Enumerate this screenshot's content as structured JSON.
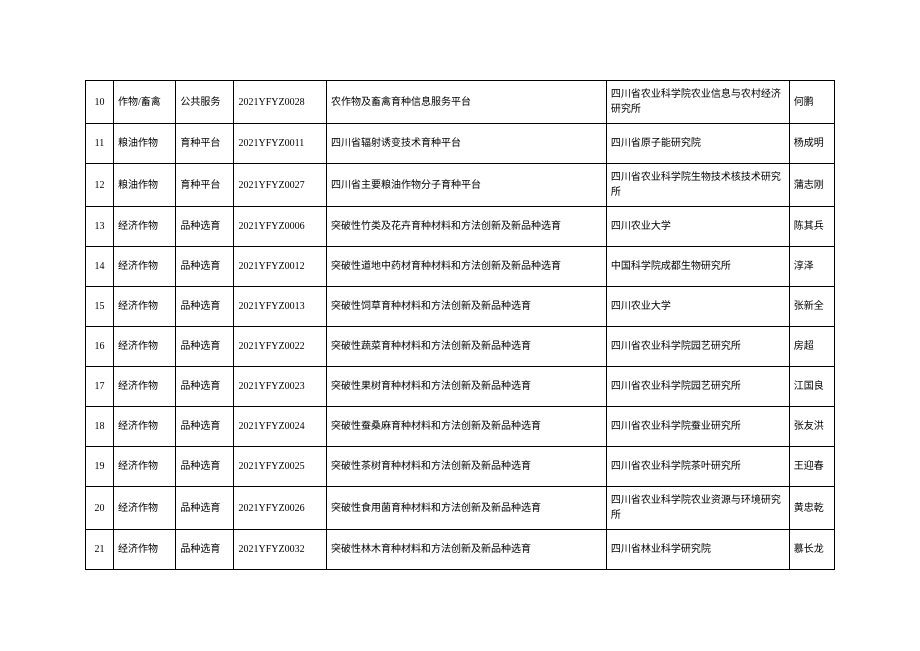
{
  "rows": [
    {
      "idx": "10",
      "cat": "作物/畜禽",
      "type": "公共服务",
      "code": "2021YFYZ0028",
      "title": "农作物及畜禽育种信息服务平台",
      "org": "四川省农业科学院农业信息与农村经济研究所",
      "person": "何鹏"
    },
    {
      "idx": "11",
      "cat": "粮油作物",
      "type": "育种平台",
      "code": "2021YFYZ0011",
      "title": "四川省辐射诱变技术育种平台",
      "org": "四川省原子能研究院",
      "person": "杨成明"
    },
    {
      "idx": "12",
      "cat": "粮油作物",
      "type": "育种平台",
      "code": "2021YFYZ0027",
      "title": "四川省主要粮油作物分子育种平台",
      "org": "四川省农业科学院生物技术核技术研究所",
      "person": "蒲志刚"
    },
    {
      "idx": "13",
      "cat": "经济作物",
      "type": "品种选育",
      "code": "2021YFYZ0006",
      "title": "突破性竹类及花卉育种材料和方法创新及新品种选育",
      "org": "四川农业大学",
      "person": "陈其兵"
    },
    {
      "idx": "14",
      "cat": "经济作物",
      "type": "品种选育",
      "code": "2021YFYZ0012",
      "title": "突破性道地中药材育种材料和方法创新及新品种选育",
      "org": "中国科学院成都生物研究所",
      "person": "淳泽"
    },
    {
      "idx": "15",
      "cat": "经济作物",
      "type": "品种选育",
      "code": "2021YFYZ0013",
      "title": "突破性饲草育种材料和方法创新及新品种选育",
      "org": "四川农业大学",
      "person": "张新全"
    },
    {
      "idx": "16",
      "cat": "经济作物",
      "type": "品种选育",
      "code": "2021YFYZ0022",
      "title": "突破性蔬菜育种材料和方法创新及新品种选育",
      "org": "四川省农业科学院园艺研究所",
      "person": "房超"
    },
    {
      "idx": "17",
      "cat": "经济作物",
      "type": "品种选育",
      "code": "2021YFYZ0023",
      "title": "突破性果树育种材料和方法创新及新品种选育",
      "org": "四川省农业科学院园艺研究所",
      "person": "江国良"
    },
    {
      "idx": "18",
      "cat": "经济作物",
      "type": "品种选育",
      "code": "2021YFYZ0024",
      "title": "突破性蚕桑麻育种材料和方法创新及新品种选育",
      "org": "四川省农业科学院蚕业研究所",
      "person": "张友洪"
    },
    {
      "idx": "19",
      "cat": "经济作物",
      "type": "品种选育",
      "code": "2021YFYZ0025",
      "title": "突破性茶树育种材料和方法创新及新品种选育",
      "org": "四川省农业科学院茶叶研究所",
      "person": "王迎春"
    },
    {
      "idx": "20",
      "cat": "经济作物",
      "type": "品种选育",
      "code": "2021YFYZ0026",
      "title": "突破性食用菌育种材料和方法创新及新品种选育",
      "org": "四川省农业科学院农业资源与环境研究所",
      "person": "黄忠乾"
    },
    {
      "idx": "21",
      "cat": "经济作物",
      "type": "品种选育",
      "code": "2021YFYZ0032",
      "title": "突破性林木育种材料和方法创新及新品种选育",
      "org": "四川省林业科学研究院",
      "person": "慕长龙"
    }
  ]
}
